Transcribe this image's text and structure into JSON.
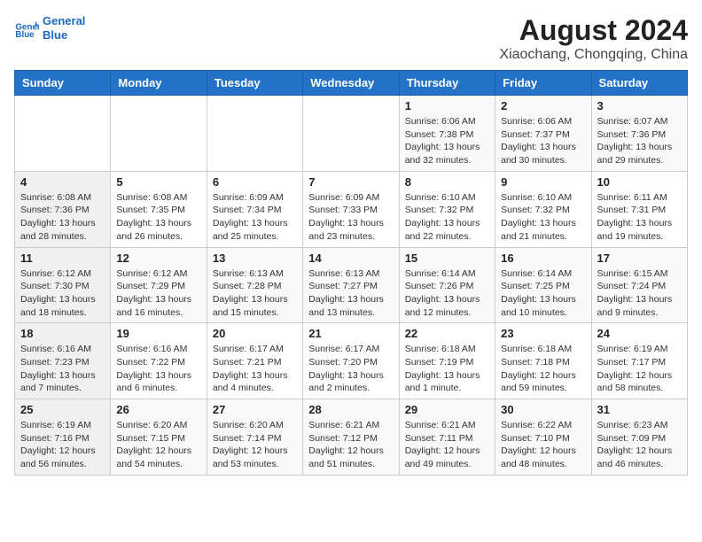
{
  "header": {
    "logo_line1": "General",
    "logo_line2": "Blue",
    "title": "August 2024",
    "subtitle": "Xiaochang, Chongqing, China"
  },
  "weekdays": [
    "Sunday",
    "Monday",
    "Tuesday",
    "Wednesday",
    "Thursday",
    "Friday",
    "Saturday"
  ],
  "weeks": [
    [
      {
        "date": "",
        "content": ""
      },
      {
        "date": "",
        "content": ""
      },
      {
        "date": "",
        "content": ""
      },
      {
        "date": "",
        "content": ""
      },
      {
        "date": "1",
        "content": "Sunrise: 6:06 AM\nSunset: 7:38 PM\nDaylight: 13 hours and 32 minutes."
      },
      {
        "date": "2",
        "content": "Sunrise: 6:06 AM\nSunset: 7:37 PM\nDaylight: 13 hours and 30 minutes."
      },
      {
        "date": "3",
        "content": "Sunrise: 6:07 AM\nSunset: 7:36 PM\nDaylight: 13 hours and 29 minutes."
      }
    ],
    [
      {
        "date": "4",
        "content": "Sunrise: 6:08 AM\nSunset: 7:36 PM\nDaylight: 13 hours and 28 minutes."
      },
      {
        "date": "5",
        "content": "Sunrise: 6:08 AM\nSunset: 7:35 PM\nDaylight: 13 hours and 26 minutes."
      },
      {
        "date": "6",
        "content": "Sunrise: 6:09 AM\nSunset: 7:34 PM\nDaylight: 13 hours and 25 minutes."
      },
      {
        "date": "7",
        "content": "Sunrise: 6:09 AM\nSunset: 7:33 PM\nDaylight: 13 hours and 23 minutes."
      },
      {
        "date": "8",
        "content": "Sunrise: 6:10 AM\nSunset: 7:32 PM\nDaylight: 13 hours and 22 minutes."
      },
      {
        "date": "9",
        "content": "Sunrise: 6:10 AM\nSunset: 7:32 PM\nDaylight: 13 hours and 21 minutes."
      },
      {
        "date": "10",
        "content": "Sunrise: 6:11 AM\nSunset: 7:31 PM\nDaylight: 13 hours and 19 minutes."
      }
    ],
    [
      {
        "date": "11",
        "content": "Sunrise: 6:12 AM\nSunset: 7:30 PM\nDaylight: 13 hours and 18 minutes."
      },
      {
        "date": "12",
        "content": "Sunrise: 6:12 AM\nSunset: 7:29 PM\nDaylight: 13 hours and 16 minutes."
      },
      {
        "date": "13",
        "content": "Sunrise: 6:13 AM\nSunset: 7:28 PM\nDaylight: 13 hours and 15 minutes."
      },
      {
        "date": "14",
        "content": "Sunrise: 6:13 AM\nSunset: 7:27 PM\nDaylight: 13 hours and 13 minutes."
      },
      {
        "date": "15",
        "content": "Sunrise: 6:14 AM\nSunset: 7:26 PM\nDaylight: 13 hours and 12 minutes."
      },
      {
        "date": "16",
        "content": "Sunrise: 6:14 AM\nSunset: 7:25 PM\nDaylight: 13 hours and 10 minutes."
      },
      {
        "date": "17",
        "content": "Sunrise: 6:15 AM\nSunset: 7:24 PM\nDaylight: 13 hours and 9 minutes."
      }
    ],
    [
      {
        "date": "18",
        "content": "Sunrise: 6:16 AM\nSunset: 7:23 PM\nDaylight: 13 hours and 7 minutes."
      },
      {
        "date": "19",
        "content": "Sunrise: 6:16 AM\nSunset: 7:22 PM\nDaylight: 13 hours and 6 minutes."
      },
      {
        "date": "20",
        "content": "Sunrise: 6:17 AM\nSunset: 7:21 PM\nDaylight: 13 hours and 4 minutes."
      },
      {
        "date": "21",
        "content": "Sunrise: 6:17 AM\nSunset: 7:20 PM\nDaylight: 13 hours and 2 minutes."
      },
      {
        "date": "22",
        "content": "Sunrise: 6:18 AM\nSunset: 7:19 PM\nDaylight: 13 hours and 1 minute."
      },
      {
        "date": "23",
        "content": "Sunrise: 6:18 AM\nSunset: 7:18 PM\nDaylight: 12 hours and 59 minutes."
      },
      {
        "date": "24",
        "content": "Sunrise: 6:19 AM\nSunset: 7:17 PM\nDaylight: 12 hours and 58 minutes."
      }
    ],
    [
      {
        "date": "25",
        "content": "Sunrise: 6:19 AM\nSunset: 7:16 PM\nDaylight: 12 hours and 56 minutes."
      },
      {
        "date": "26",
        "content": "Sunrise: 6:20 AM\nSunset: 7:15 PM\nDaylight: 12 hours and 54 minutes."
      },
      {
        "date": "27",
        "content": "Sunrise: 6:20 AM\nSunset: 7:14 PM\nDaylight: 12 hours and 53 minutes."
      },
      {
        "date": "28",
        "content": "Sunrise: 6:21 AM\nSunset: 7:12 PM\nDaylight: 12 hours and 51 minutes."
      },
      {
        "date": "29",
        "content": "Sunrise: 6:21 AM\nSunset: 7:11 PM\nDaylight: 12 hours and 49 minutes."
      },
      {
        "date": "30",
        "content": "Sunrise: 6:22 AM\nSunset: 7:10 PM\nDaylight: 12 hours and 48 minutes."
      },
      {
        "date": "31",
        "content": "Sunrise: 6:23 AM\nSunset: 7:09 PM\nDaylight: 12 hours and 46 minutes."
      }
    ]
  ]
}
